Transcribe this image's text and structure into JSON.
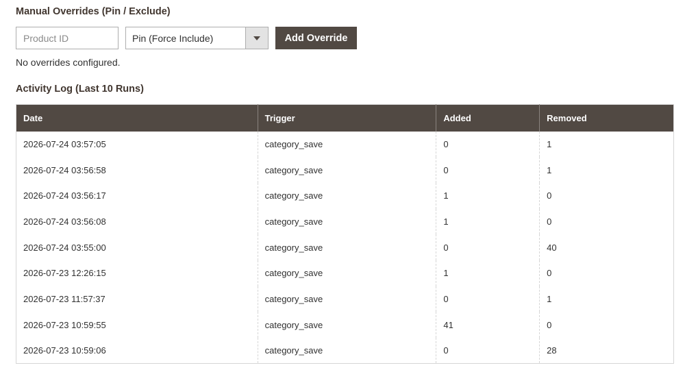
{
  "overrides": {
    "title": "Manual Overrides (Pin / Exclude)",
    "product_id_placeholder": "Product ID",
    "product_id_value": "",
    "mode_selected": "Pin (Force Include)",
    "add_button_label": "Add Override",
    "empty_message": "No overrides configured."
  },
  "activity": {
    "title": "Activity Log (Last 10 Runs)",
    "columns": [
      "Date",
      "Trigger",
      "Added",
      "Removed"
    ],
    "rows": [
      {
        "date": "2026-07-24 03:57:05",
        "trigger": "category_save",
        "added": "0",
        "removed": "1"
      },
      {
        "date": "2026-07-24 03:56:58",
        "trigger": "category_save",
        "added": "0",
        "removed": "1"
      },
      {
        "date": "2026-07-24 03:56:17",
        "trigger": "category_save",
        "added": "1",
        "removed": "0"
      },
      {
        "date": "2026-07-24 03:56:08",
        "trigger": "category_save",
        "added": "1",
        "removed": "0"
      },
      {
        "date": "2026-07-24 03:55:00",
        "trigger": "category_save",
        "added": "0",
        "removed": "40"
      },
      {
        "date": "2026-07-23 12:26:15",
        "trigger": "category_save",
        "added": "1",
        "removed": "0"
      },
      {
        "date": "2026-07-23 11:57:37",
        "trigger": "category_save",
        "added": "0",
        "removed": "1"
      },
      {
        "date": "2026-07-23 10:59:55",
        "trigger": "category_save",
        "added": "41",
        "removed": "0"
      },
      {
        "date": "2026-07-23 10:59:06",
        "trigger": "category_save",
        "added": "0",
        "removed": "28"
      }
    ]
  },
  "colors": {
    "header_bg": "#514943",
    "button_bg": "#514943",
    "title_text": "#41362f"
  },
  "icons": {
    "select_arrow": "triangle-down-icon"
  }
}
